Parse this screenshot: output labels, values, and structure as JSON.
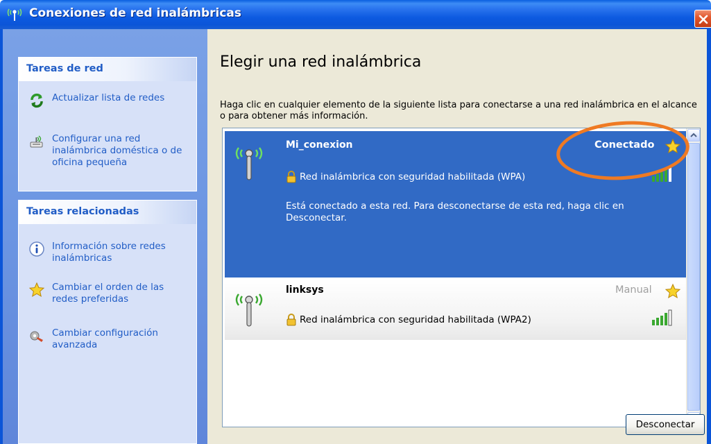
{
  "window": {
    "title": "Conexiones de red inalámbricas"
  },
  "sidebar": {
    "groups": [
      {
        "header": "Tareas de red",
        "items": [
          {
            "label": "Actualizar lista de redes",
            "icon": "refresh-icon"
          },
          {
            "label": "Configurar una red inalámbrica doméstica o de oficina pequeña",
            "icon": "wireless-setup-icon"
          }
        ]
      },
      {
        "header": "Tareas relacionadas",
        "items": [
          {
            "label": "Información sobre redes inalámbricas",
            "icon": "info-icon"
          },
          {
            "label": "Cambiar el orden de las redes preferidas",
            "icon": "star-icon"
          },
          {
            "label": "Cambiar configuración avanzada",
            "icon": "advanced-settings-icon"
          }
        ]
      }
    ]
  },
  "main": {
    "title": "Elegir una red inalámbrica",
    "description": "Haga clic en cualquier elemento de la siguiente lista para conectarse a una red inalámbrica en el alcance o para obtener más información.",
    "networks": [
      {
        "name": "Mi_conexion",
        "status": "Conectado",
        "security": "Red inalámbrica con seguridad habilitada (WPA)",
        "message": "Está conectado a esta red. Para desconectarse de esta red, haga clic en Desconectar.",
        "selected": true,
        "signal_bars": 5
      },
      {
        "name": "linksys",
        "status": "Manual",
        "security": "Red inalámbrica con seguridad habilitada (WPA2)",
        "selected": false,
        "signal_bars": 5
      }
    ],
    "disconnect_label": "Desconectar"
  },
  "colors": {
    "titlebar": "#0b55d8",
    "selection": "#316ac5",
    "link": "#215dc6",
    "highlight_circle": "#ef7a23",
    "signal_green": "#3aa830"
  }
}
